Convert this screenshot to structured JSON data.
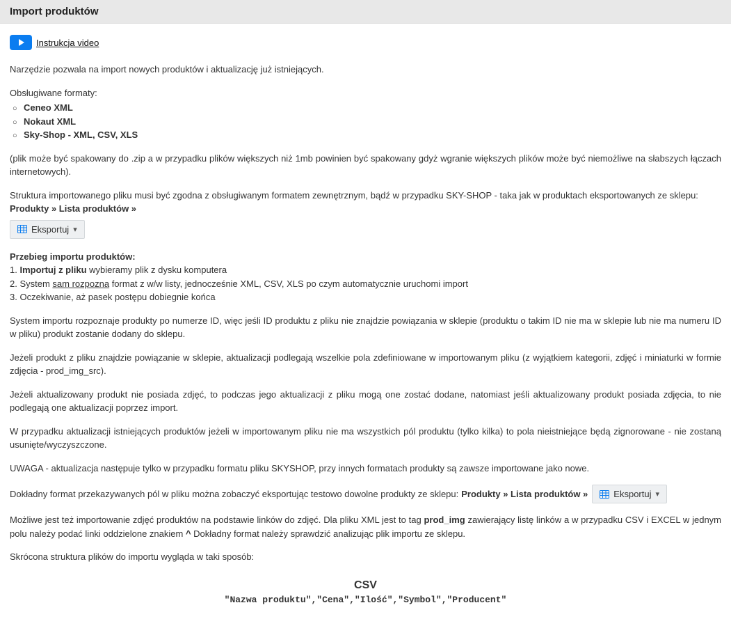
{
  "page": {
    "title": "Import produktów"
  },
  "video": {
    "link_text": "Instrukcja video"
  },
  "intro": {
    "line1": "Narzędzie pozwala na import nowych produktów i aktualizację już istniejących.",
    "formats_label": "Obsługiwane formaty:",
    "formats": [
      "Ceneo XML",
      "Nokaut XML",
      "Sky-Shop - XML, CSV, XLS"
    ],
    "zip_note": "(plik może być spakowany do .zip a w przypadku plików większych niż 1mb powinien być spakowany gdyż wgranie większych plików może być niemożliwe na słabszych łączach internetowych)."
  },
  "structure": {
    "text_pre": "Struktura importowanego pliku musi być zgodna z obsługiwanym formatem zewnętrznym, bądź w przypadku SKY-SHOP - taka jak w produktach eksportowanych ze sklepu: ",
    "bold_path": "Produkty » Lista produktów »",
    "export_btn": "Eksportuj"
  },
  "flow": {
    "heading": "Przebieg importu produktów:",
    "step1": {
      "pre": "1. ",
      "bold": "Importuj z pliku",
      "rest": " wybieramy plik z dysku komputera"
    },
    "step2": {
      "pre": "2. System ",
      "underline": "sam rozpozna",
      "rest": " format z w/w listy, jednocześnie XML, CSV, XLS po czym automatycznie uruchomi import"
    },
    "step3": "3. Oczekiwanie, aż pasek postępu dobiegnie końca"
  },
  "notes": {
    "p1": "System importu rozpoznaje produkty po numerze ID, więc jeśli ID produktu z pliku nie znajdzie powiązania w sklepie (produktu o takim ID nie ma w sklepie lub nie ma numeru ID w pliku) produkt zostanie dodany do sklepu.",
    "p2": "Jeżeli produkt z pliku znajdzie powiązanie w sklepie, aktualizacji podlegają wszelkie pola zdefiniowane w importowanym pliku (z wyjątkiem kategorii, zdjęć i miniaturki w formie zdjęcia - prod_img_src).",
    "p3": "Jeżeli aktualizowany produkt nie posiada zdjęć, to podczas jego aktualizacji z pliku mogą one zostać dodane, natomiast jeśli aktualizowany produkt posiada zdjęcia, to nie podlegają one aktualizacji poprzez import.",
    "p4": "W przypadku aktualizacji istniejących produktów jeżeli w importowanym pliku nie ma wszystkich pól produktu (tylko kilka) to pola nieistniejące będą zignorowane - nie zostaną usunięte/wyczyszczone.",
    "p5": "UWAGA - aktualizacja następuje tylko w przypadku formatu pliku SKYSHOP, przy innych formatach produkty są zawsze importowane jako nowe."
  },
  "export2": {
    "text_pre": "Dokładny format przekazywanych pól w pliku można zobaczyć eksportując testowo dowolne produkty ze sklepu: ",
    "bold_path": "Produkty » Lista produktów »",
    "export_btn": "Eksportuj"
  },
  "images_note": {
    "text_pre": "Możliwe jest też importowanie zdjęć produktów na podstawie linków do zdjęć. Dla pliku XML jest to tag ",
    "bold_tag": "prod_img",
    "text_mid": " zawierający listę linków a w przypadku CSV i EXCEL w jednym polu należy podać linki oddzielone znakiem ",
    "bold_sep": "^",
    "text_post": " Dokładny format należy sprawdzić analizując plik importu ze sklepu."
  },
  "shortstruct": {
    "label": "Skrócona struktura plików do importu wygląda w taki sposób:"
  },
  "csv": {
    "title": "CSV",
    "line": "\"Nazwa produktu\",\"Cena\",\"Ilość\",\"Symbol\",\"Producent\""
  }
}
